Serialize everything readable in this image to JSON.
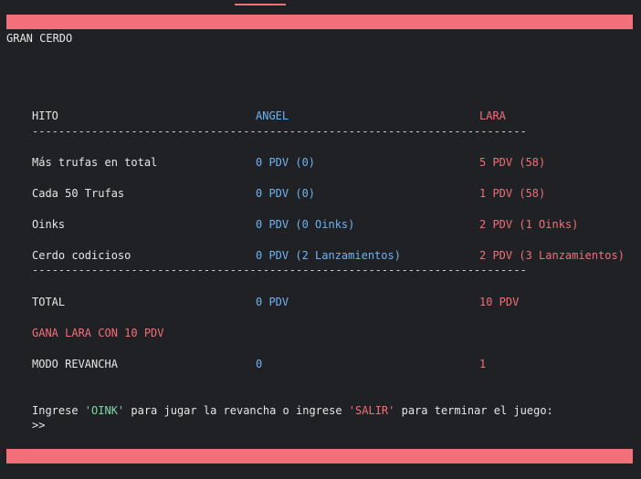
{
  "title": "GRAN CERDO",
  "header": {
    "milestone": "HITO",
    "player1": "ANGEL",
    "player2": "LARA"
  },
  "separator": "---------------------------------------------------------------------------",
  "rows": [
    {
      "label": "Más trufas en total",
      "p1": "0 PDV (0)",
      "p2": "5 PDV (58)"
    },
    {
      "label": "Cada 50 Trufas",
      "p1": "0 PDV (0)",
      "p2": "1 PDV (58)"
    },
    {
      "label": "Oinks",
      "p1": "0 PDV (0 Oinks)",
      "p2": "2 PDV (1 Oinks)"
    },
    {
      "label": "Cerdo codicioso",
      "p1": "0 PDV (2 Lanzamientos)",
      "p2": "2 PDV (3 Lanzamientos)"
    }
  ],
  "total": {
    "label": "TOTAL",
    "p1": "0 PDV",
    "p2": "10 PDV"
  },
  "winner": "GANA LARA CON 10 PDV",
  "rematch": {
    "label": "MODO REVANCHA",
    "p1": "0",
    "p2": "1"
  },
  "prompt": {
    "before": "Ingrese ",
    "oink": "'OINK'",
    "middle": " para jugar la revancha o ingrese ",
    "salir": "'SALIR'",
    "after": " para terminar el juego:",
    "cursor": ">>"
  },
  "colors": {
    "accent": "#f3707a",
    "player1": "#6fb3f2",
    "player2": "#f3707a",
    "keyword": "#7fd6a8",
    "background": "#1f2125"
  }
}
